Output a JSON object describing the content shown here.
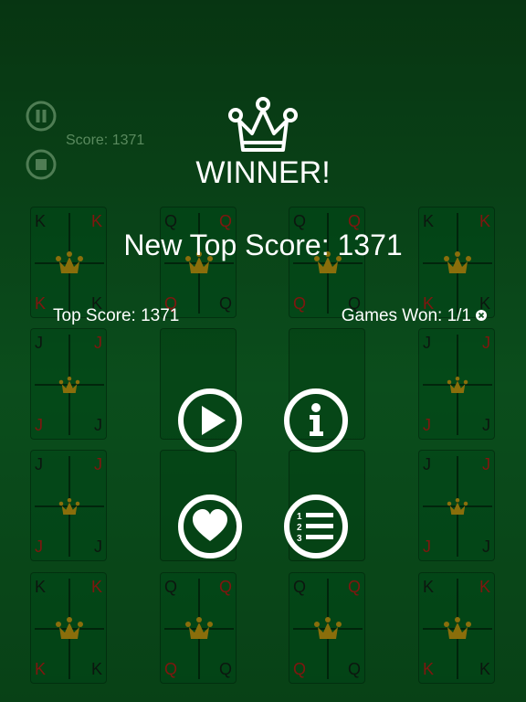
{
  "hud": {
    "score_text": "Score: 1371"
  },
  "overlay": {
    "title": "WINNER!",
    "new_top": "New Top Score: 1371",
    "top_score": "Top Score: 1371",
    "games_won": "Games Won: 1/1"
  },
  "buttons": [
    "play",
    "info",
    "favorite",
    "leaderboard"
  ],
  "icons": {
    "pause": "pause-icon",
    "stop": "stop-icon",
    "crown": "crown-icon",
    "reset": "close-icon"
  },
  "colors": {
    "background": "#0f5a22",
    "red_rank": "#aa1111",
    "crown_gold": "#b8860b"
  },
  "cards": [
    {
      "tl": "K",
      "tr": "K",
      "bl": "K",
      "br": "K",
      "red": [
        "tr",
        "bl"
      ],
      "crown": true
    },
    {
      "tl": "Q",
      "tr": "Q",
      "bl": "Q",
      "br": "Q",
      "red": [
        "tr",
        "bl"
      ],
      "crown": true
    },
    {
      "tl": "Q",
      "tr": "Q",
      "bl": "Q",
      "br": "Q",
      "red": [
        "tr",
        "bl"
      ],
      "crown": true
    },
    {
      "tl": "K",
      "tr": "K",
      "bl": "K",
      "br": "K",
      "red": [
        "tr",
        "bl"
      ],
      "crown": true
    },
    {
      "tl": "J",
      "tr": "J",
      "bl": "J",
      "br": "J",
      "red": [
        "tr",
        "bl"
      ],
      "crown": true,
      "small": true
    },
    {
      "empty": true
    },
    {
      "empty": true
    },
    {
      "tl": "J",
      "tr": "J",
      "bl": "J",
      "br": "J",
      "red": [
        "tr",
        "bl"
      ],
      "crown": true,
      "small": true
    },
    {
      "tl": "J",
      "tr": "J",
      "bl": "J",
      "br": "J",
      "red": [
        "tr",
        "bl"
      ],
      "crown": true,
      "small": true
    },
    {
      "empty": true
    },
    {
      "empty": true
    },
    {
      "tl": "J",
      "tr": "J",
      "bl": "J",
      "br": "J",
      "red": [
        "tr",
        "bl"
      ],
      "crown": true,
      "small": true
    },
    {
      "tl": "K",
      "tr": "K",
      "bl": "K",
      "br": "K",
      "red": [
        "tr",
        "bl"
      ],
      "crown": true
    },
    {
      "tl": "Q",
      "tr": "Q",
      "bl": "Q",
      "br": "Q",
      "red": [
        "tr",
        "bl"
      ],
      "crown": true
    },
    {
      "tl": "Q",
      "tr": "Q",
      "bl": "Q",
      "br": "Q",
      "red": [
        "tr",
        "bl"
      ],
      "crown": true
    },
    {
      "tl": "K",
      "tr": "K",
      "bl": "K",
      "br": "K",
      "red": [
        "tr",
        "bl"
      ],
      "crown": true
    }
  ]
}
